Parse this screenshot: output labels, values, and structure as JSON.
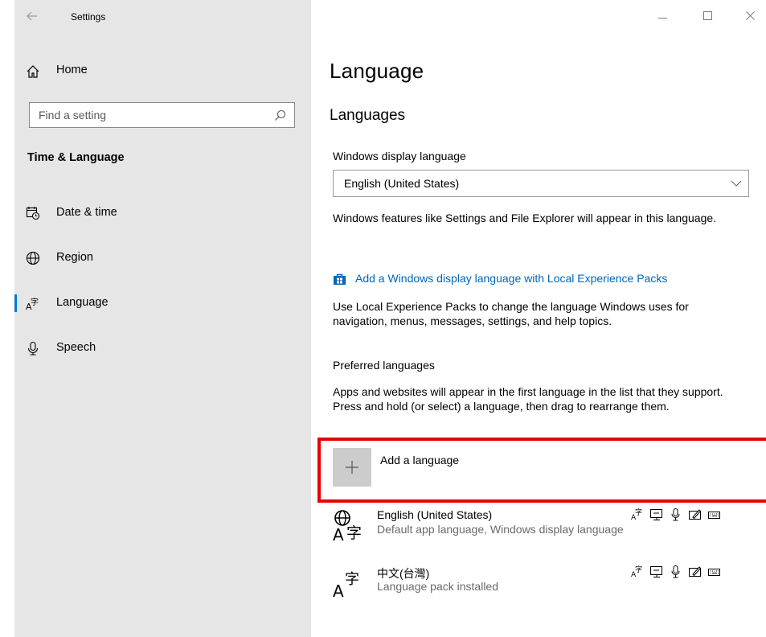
{
  "window": {
    "title": "Settings",
    "controls": [
      "minimize-icon",
      "maximize-icon",
      "close-icon"
    ]
  },
  "sidebar": {
    "home_label": "Home",
    "search_placeholder": "Find a setting",
    "section_title": "Time & Language",
    "items": [
      {
        "label": "Date & time",
        "icon": "calendar-clock-icon",
        "active": false
      },
      {
        "label": "Region",
        "icon": "globe-icon",
        "active": false
      },
      {
        "label": "Language",
        "icon": "language-icon",
        "active": true
      },
      {
        "label": "Speech",
        "icon": "microphone-icon",
        "active": false
      }
    ]
  },
  "main": {
    "title": "Language",
    "subtitle": "Languages",
    "display_language_label": "Windows display language",
    "display_language_value": "English (United States)",
    "display_language_desc": "Windows features like Settings and File Explorer will appear in this language.",
    "lxp_link": "Add a Windows display language with Local Experience Packs",
    "lxp_desc": "Use Local Experience Packs to change the language Windows uses for navigation, menus, messages, settings, and help topics.",
    "preferred_label": "Preferred languages",
    "preferred_desc": "Apps and websites will appear in the first language in the list that they support. Press and hold (or select) a language, then drag to rearrange them.",
    "add_language_label": "Add a language",
    "languages": [
      {
        "name": "English (United States)",
        "desc": "Default app language, Windows display language",
        "icon": "language-globe-icon"
      },
      {
        "name": "中文(台灣)",
        "desc": "Language pack installed",
        "icon": "language-character-icon"
      }
    ],
    "feature_icons": [
      "display-language-icon",
      "text-to-speech-icon",
      "speech-recognition-icon",
      "handwriting-icon",
      "keyboard-icon"
    ]
  },
  "colors": {
    "accent": "#0078d7",
    "link": "#0067b8",
    "highlight": "#e80000",
    "sidebar_bg": "#e6e6e6"
  }
}
